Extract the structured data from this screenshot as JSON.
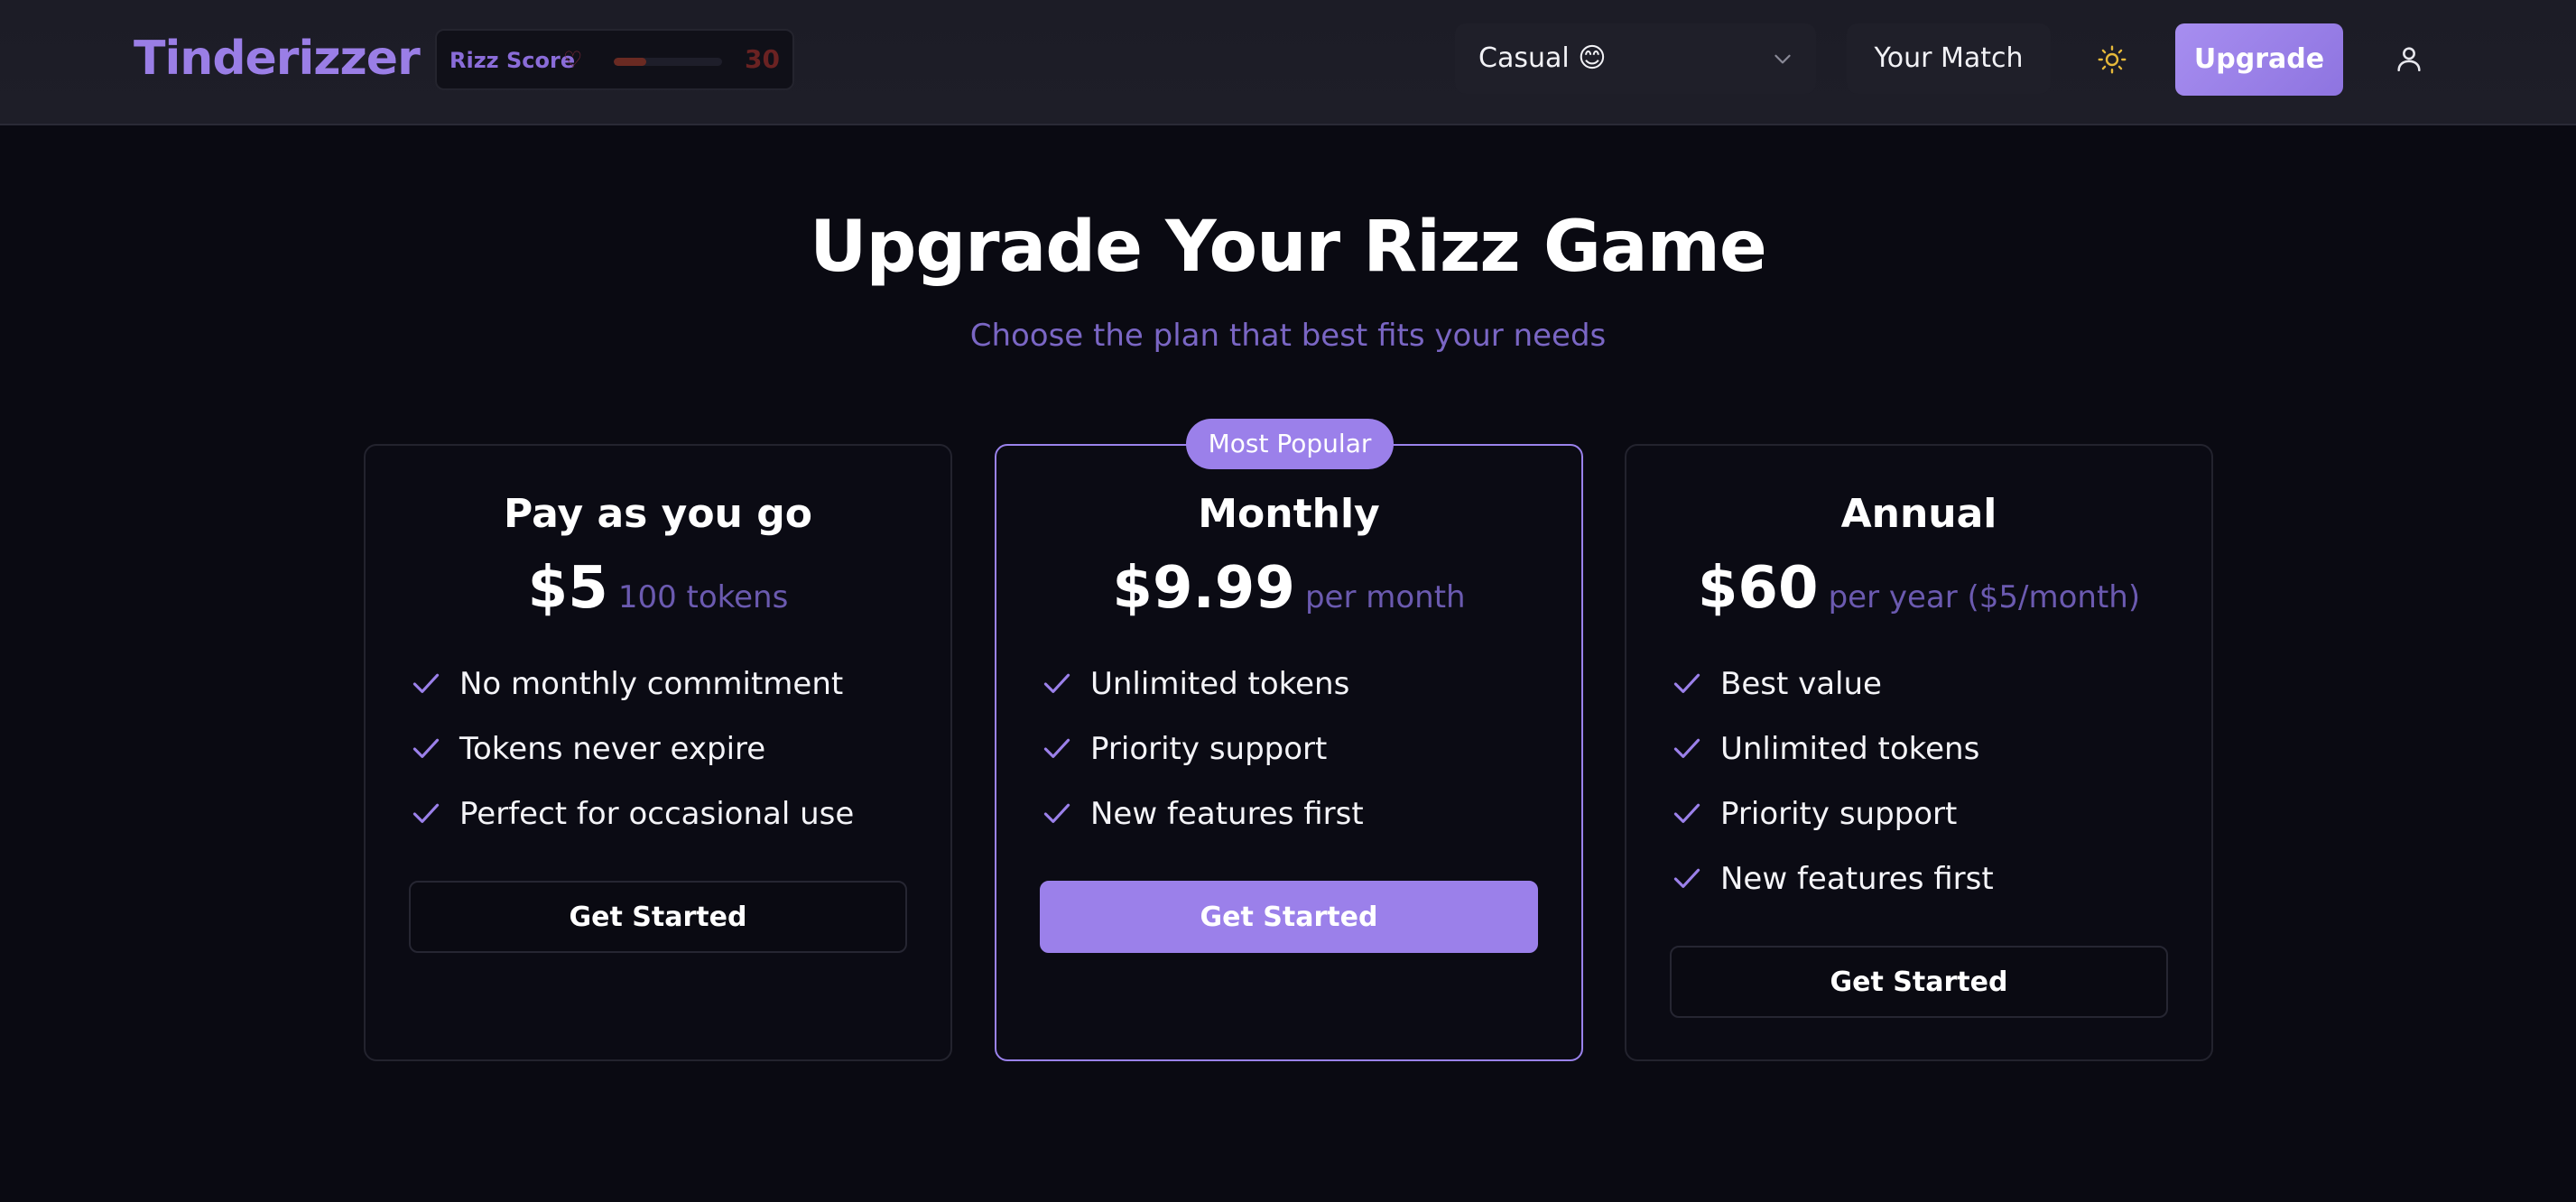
{
  "header": {
    "logo": "Tinderizzer",
    "rizz_score": {
      "label": "Rizz Score",
      "heart": "♡",
      "value": "30",
      "progress_fraction": 0.3
    },
    "mode_select": {
      "value": "Casual 😊"
    },
    "your_match_label": "Your Match",
    "upgrade_label": "Upgrade"
  },
  "hero": {
    "title": "Upgrade Your Rizz Game",
    "subtitle": "Choose the plan that best fits your needs"
  },
  "plans": [
    {
      "name": "Pay as you go",
      "price": "$5",
      "period": "100 tokens",
      "features": [
        "No monthly commitment",
        "Tokens never expire",
        "Perfect for occasional use"
      ],
      "cta": "Get Started"
    },
    {
      "badge": "Most Popular",
      "name": "Monthly",
      "price": "$9.99",
      "period": "per month",
      "features": [
        "Unlimited tokens",
        "Priority support",
        "New features first"
      ],
      "cta": "Get Started"
    },
    {
      "name": "Annual",
      "price": "$60",
      "period": "per year ($5/month)",
      "features": [
        "Best value",
        "Unlimited tokens",
        "Priority support",
        "New features first"
      ],
      "cta": "Get Started"
    }
  ],
  "colors": {
    "accent": "#9b80ea",
    "background": "#0a0a12",
    "header": "#1e1e28",
    "subtitle": "#7a66c4",
    "rizz_bar": "#6a2a22"
  },
  "icons": {
    "mode_select": "chevron-down-icon",
    "theme_toggle": "sun-icon",
    "account": "user-icon",
    "feature": "check-icon"
  }
}
